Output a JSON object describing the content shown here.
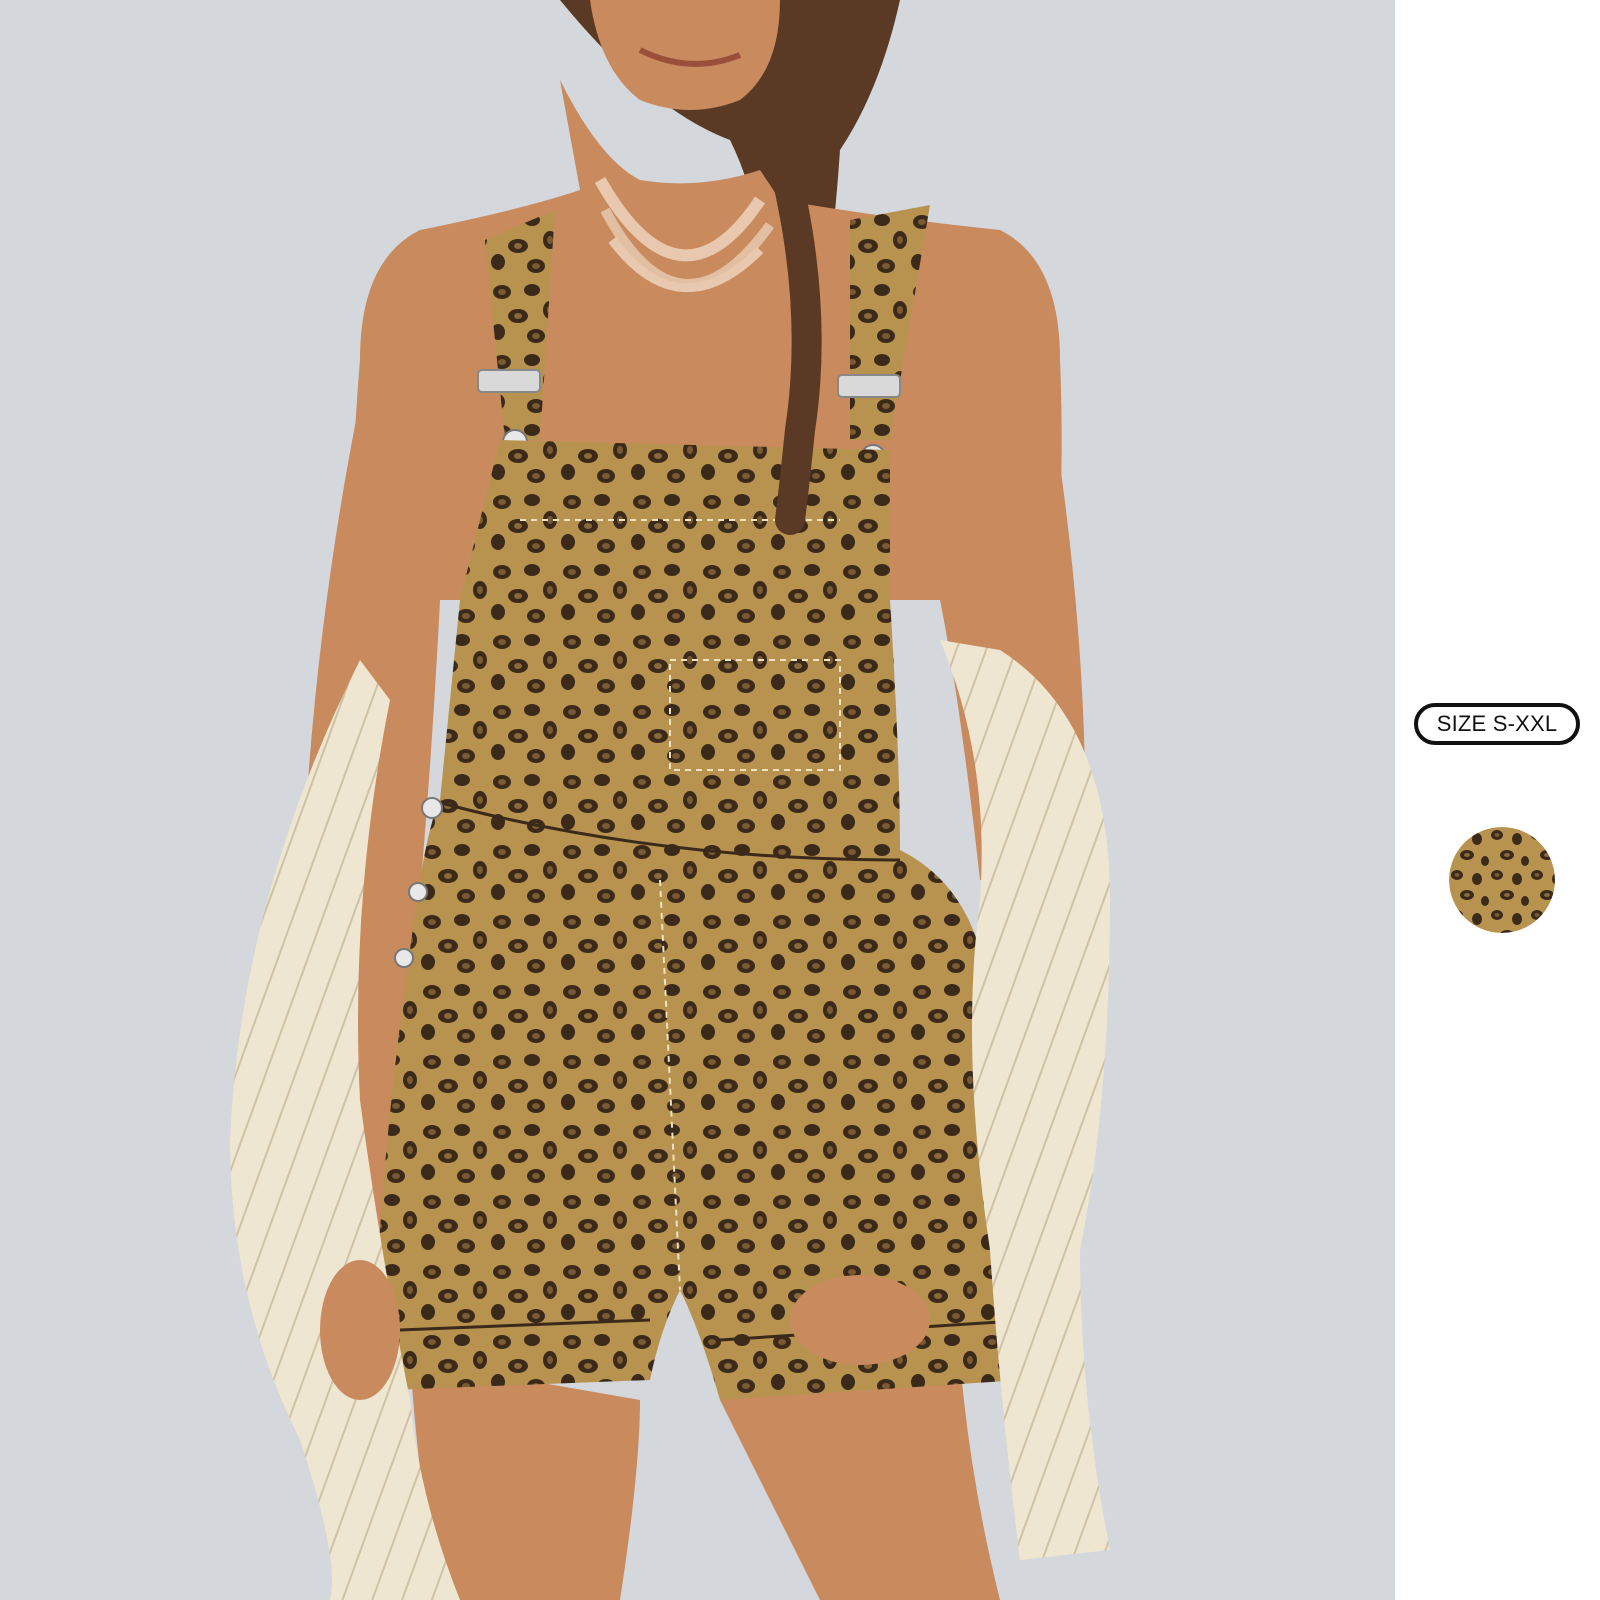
{
  "size_badge": {
    "label": "SIZE S-XXL"
  },
  "swatch": {
    "pattern": "leopard-print",
    "colors": [
      "#b8934f",
      "#3b2a1a",
      "#7a5a32"
    ]
  },
  "photo": {
    "background_color": "#d4d7db"
  }
}
